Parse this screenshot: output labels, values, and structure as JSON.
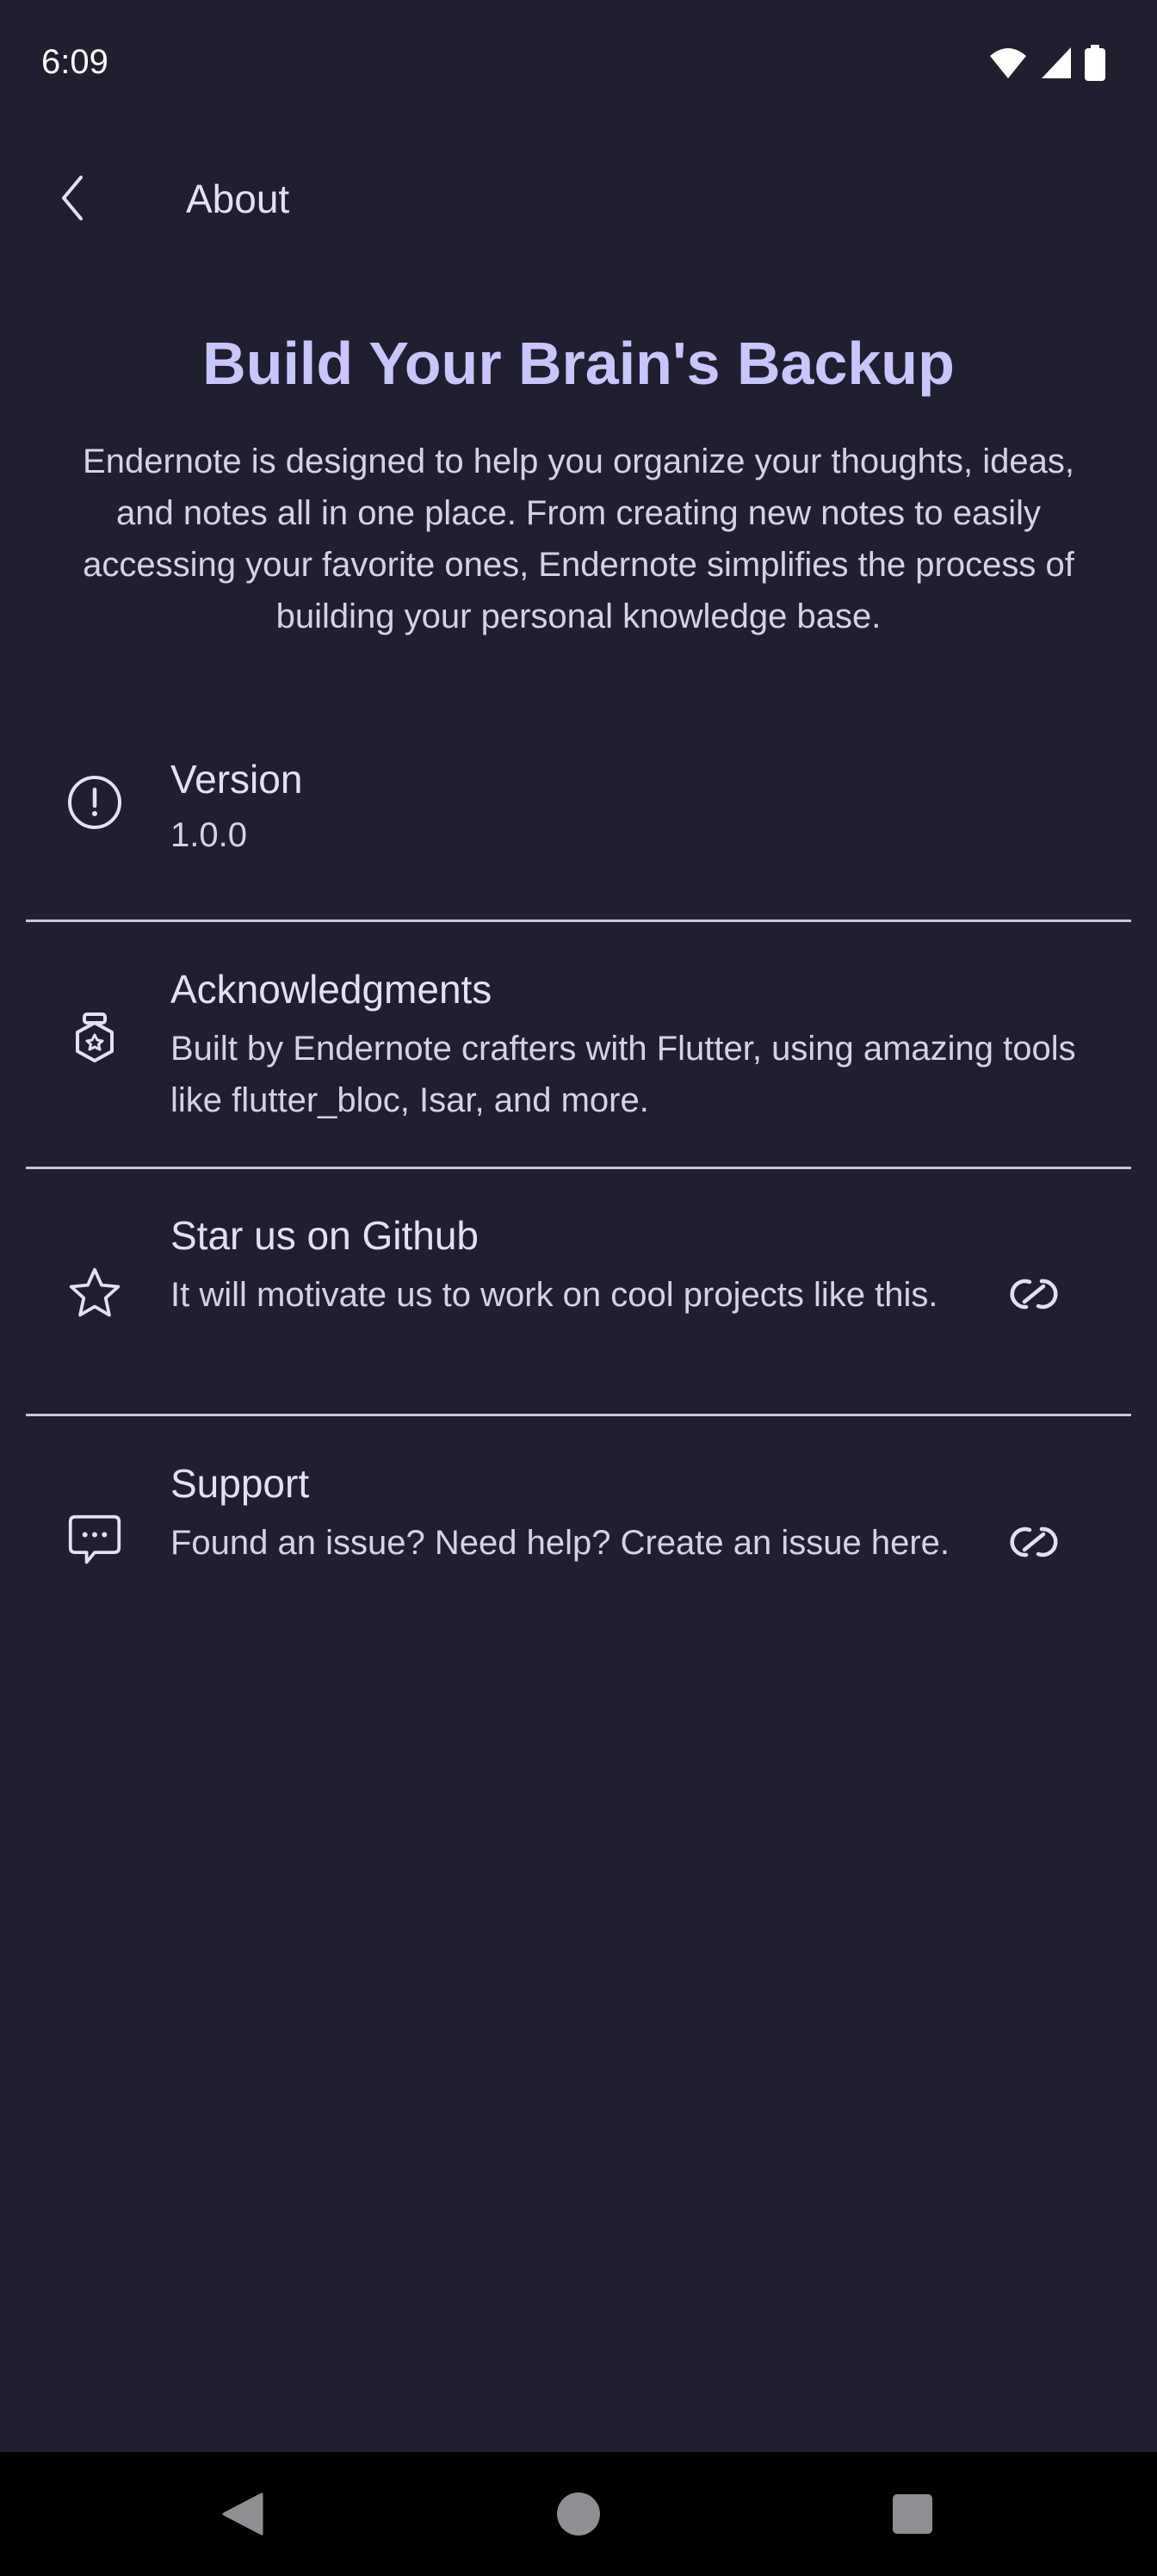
{
  "status_bar": {
    "time": "6:09"
  },
  "app_bar": {
    "title": "About",
    "back_icon": "chevron-left-icon"
  },
  "hero": {
    "title": "Build Your Brain's Backup",
    "description": "Endernote is designed to help you organize your thoughts, ideas, and notes all in one place. From creating new notes to easily accessing your favorite ones, Endernote simplifies the process of building your personal knowledge base."
  },
  "items": [
    {
      "icon": "info-circle-icon",
      "title": "Version",
      "subtitle": "1.0.0"
    },
    {
      "icon": "badge-icon",
      "title": "Acknowledgments",
      "subtitle": "Built by Endernote crafters with Flutter, using amazing tools like flutter_bloc, Isar, and more."
    },
    {
      "icon": "star-icon",
      "title": "Star us on Github",
      "subtitle": "It will motivate us to work on cool projects like this.",
      "trailing_icon": "link-icon"
    },
    {
      "icon": "chat-bubble-icon",
      "title": "Support",
      "subtitle": "Found an issue? Need help? Create an issue here.",
      "trailing_icon": "link-icon"
    }
  ],
  "colors": {
    "background": "#201f2f",
    "accent": "#c7c6ff",
    "text": "#e2e1f2",
    "divider": "#c8c7d8",
    "nav_bar": "#000000"
  }
}
